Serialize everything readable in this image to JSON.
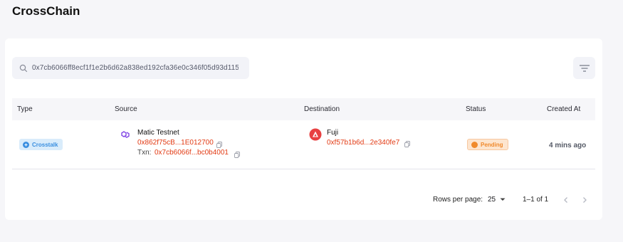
{
  "page": {
    "title": "CrossChain"
  },
  "search": {
    "value": "0x7cb6066ff8ecf1f1e2b6d62a838ed192cfa36e0c346f05d93d115",
    "icon": "search-icon"
  },
  "filter": {
    "icon": "filter-icon"
  },
  "table": {
    "headers": {
      "type": "Type",
      "source": "Source",
      "destination": "Destination",
      "status": "Status",
      "created": "Created At"
    },
    "rows": [
      {
        "type": "Crosstalk",
        "source": {
          "chain": "Matic Testnet",
          "address": "0x862f75cB...1E012700",
          "txn_label": "Txn:",
          "txn": "0x7cb6066f...bc0b4001"
        },
        "destination": {
          "chain": "Fuji",
          "address": "0xf57b1b6d...2e340fe7"
        },
        "status": "Pending",
        "created": "4 mins ago"
      }
    ]
  },
  "pagination": {
    "rows_per_page_label": "Rows per page:",
    "rows_per_page": "25",
    "range": "1–1 of 1"
  },
  "colors": {
    "address": "#e23a13",
    "crosstalk": "#3a8fe0",
    "pending": "#f08a2c",
    "matic": "#8247e5",
    "avalanche": "#e84142"
  }
}
